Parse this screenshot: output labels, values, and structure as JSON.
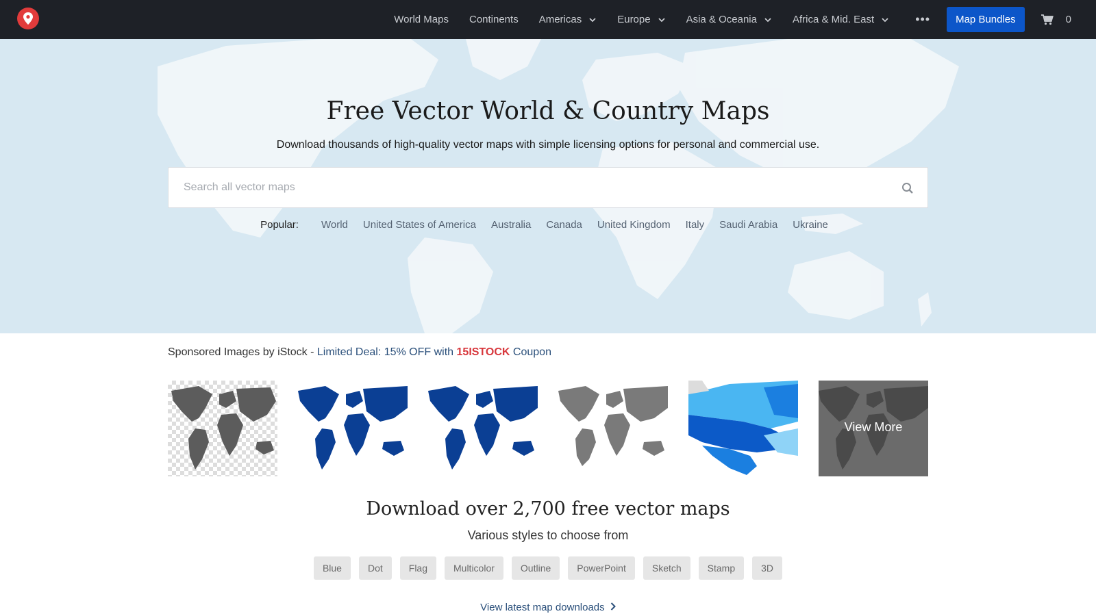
{
  "nav": {
    "logo_icon": "map-pin-icon",
    "items": [
      {
        "label": "World Maps",
        "dropdown": false
      },
      {
        "label": "Continents",
        "dropdown": false
      },
      {
        "label": "Americas",
        "dropdown": true
      },
      {
        "label": "Europe",
        "dropdown": true
      },
      {
        "label": "Asia & Oceania",
        "dropdown": true
      },
      {
        "label": "Africa & Mid. East",
        "dropdown": true
      }
    ],
    "more_label": "•••",
    "bundles_label": "Map Bundles",
    "cart_count": "0"
  },
  "hero": {
    "title": "Free Vector World & Country Maps",
    "subtitle": "Download thousands of high-quality vector maps with simple licensing options for personal and commercial use.",
    "search_placeholder": "Search all vector maps",
    "popular_label": "Popular:",
    "popular": [
      "World",
      "United States of America",
      "Australia",
      "Canada",
      "United Kingdom",
      "Italy",
      "Saudi Arabia",
      "Ukraine"
    ]
  },
  "sponsored": {
    "prefix": "Sponsored Images by iStock - ",
    "deal_text": "Limited Deal: 15% OFF with ",
    "code": "15ISTOCK",
    "suffix": " Coupon",
    "view_more": "View More"
  },
  "download": {
    "title": "Download over 2,700 free vector maps",
    "subtitle": "Various styles to choose from",
    "styles": [
      "Blue",
      "Dot",
      "Flag",
      "Multicolor",
      "Outline",
      "PowerPoint",
      "Sketch",
      "Stamp",
      "3D"
    ],
    "latest_link": "View latest map downloads"
  },
  "colors": {
    "nav_bg": "#1e2127",
    "accent": "#0c56c9",
    "hero_bg": "#d7e8f2",
    "coupon_red": "#d8383d",
    "link_blue": "#2a4f7a"
  }
}
